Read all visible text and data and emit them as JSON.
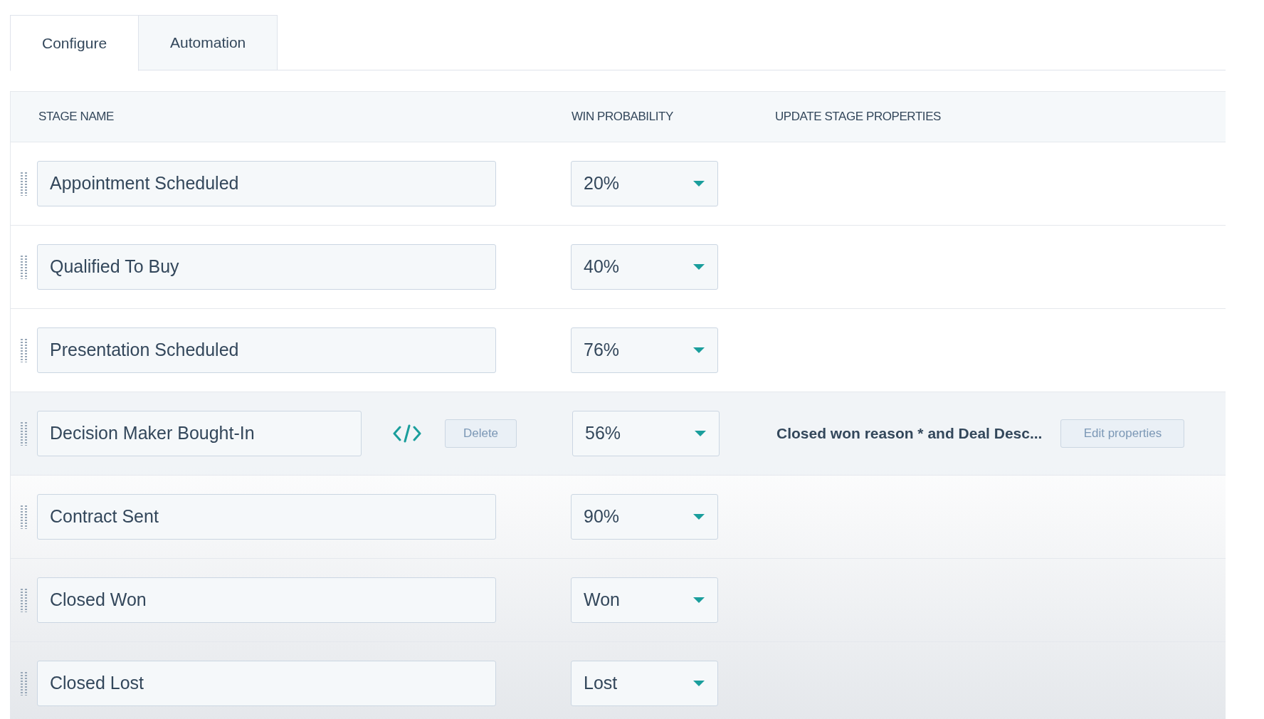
{
  "tabs": [
    {
      "label": "Configure",
      "selected": true
    },
    {
      "label": "Automation",
      "selected": false
    }
  ],
  "table": {
    "columns": [
      "STAGE NAME",
      "WIN PROBABILITY",
      "UPDATE STAGE PROPERTIES"
    ],
    "rows": [
      {
        "name": "Appointment Scheduled",
        "probability": "20%",
        "highlighted": false
      },
      {
        "name": "Qualified To Buy",
        "probability": "40%",
        "highlighted": false
      },
      {
        "name": "Presentation Scheduled",
        "probability": "76%",
        "highlighted": false
      },
      {
        "name": "Decision Maker Bought-In",
        "probability": "56%",
        "highlighted": true,
        "delete_label": "Delete",
        "properties": "Closed won reason * and Deal Desc...",
        "edit_label": "Edit properties"
      },
      {
        "name": "Contract Sent",
        "probability": "90%",
        "highlighted": false
      },
      {
        "name": "Closed Won",
        "probability": "Won",
        "highlighted": false
      },
      {
        "name": "Closed Lost",
        "probability": "Lost",
        "highlighted": false
      }
    ]
  }
}
